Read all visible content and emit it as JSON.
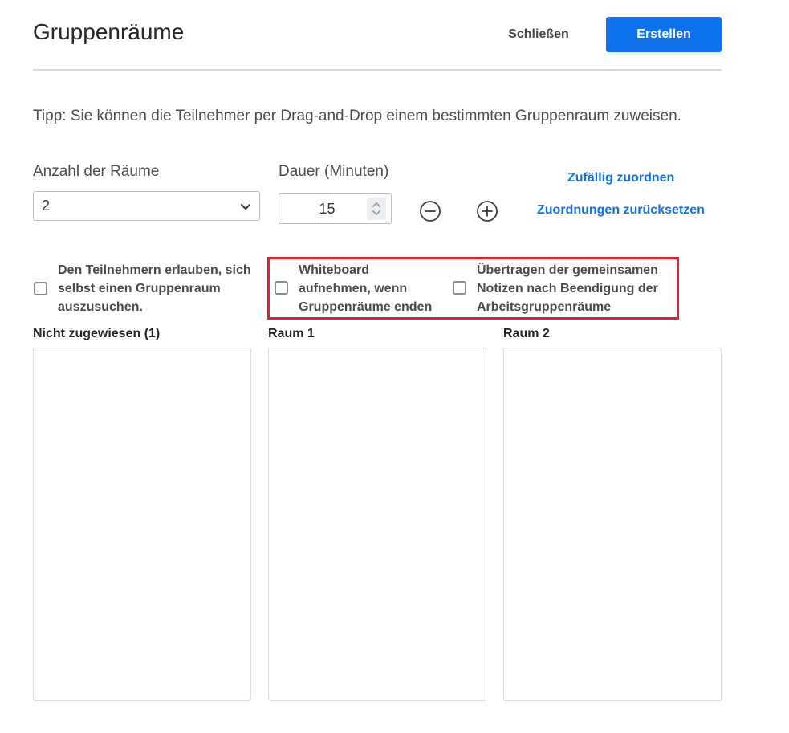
{
  "header": {
    "title": "Gruppenräume",
    "close_label": "Schließen",
    "create_label": "Erstellen"
  },
  "tip": "Tipp: Sie können die Teilnehmer per Drag-and-Drop einem bestimmten Gruppenraum zuweisen.",
  "rooms": {
    "label": "Anzahl der Räume",
    "selected_value": "2"
  },
  "duration": {
    "label": "Dauer (Minuten)",
    "value": "15"
  },
  "links": {
    "random_assign": "Zufällig zuordnen",
    "reset_assign": "Zuordnungen zurücksetzen"
  },
  "options": [
    {
      "line1": "Den Teilnehmern erlauben, sich",
      "line2": "selbst einen Gruppenraum",
      "line3": "auszusuchen.",
      "checked": false
    },
    {
      "line1": "Whiteboard",
      "line2": "aufnehmen, wenn",
      "line3": "Gruppenräume enden",
      "checked": false
    },
    {
      "line1": "Übertragen der gemeinsamen",
      "line2": "Notizen nach Beendigung der",
      "line3": "Arbeitsgruppenräume",
      "checked": false
    }
  ],
  "columns": [
    {
      "title": "Nicht zugewiesen (1)"
    },
    {
      "title": "Raum 1"
    },
    {
      "title": "Raum 2"
    }
  ],
  "colors": {
    "accent": "#0e72ed",
    "highlight_border": "#e0212e",
    "divider": "#d5d8de"
  },
  "icons": {
    "select_chevron": "chevron-down-icon",
    "spinner": "spinner-arrows-icon",
    "decrement": "minus-circle-icon",
    "increment": "plus-circle-icon"
  }
}
